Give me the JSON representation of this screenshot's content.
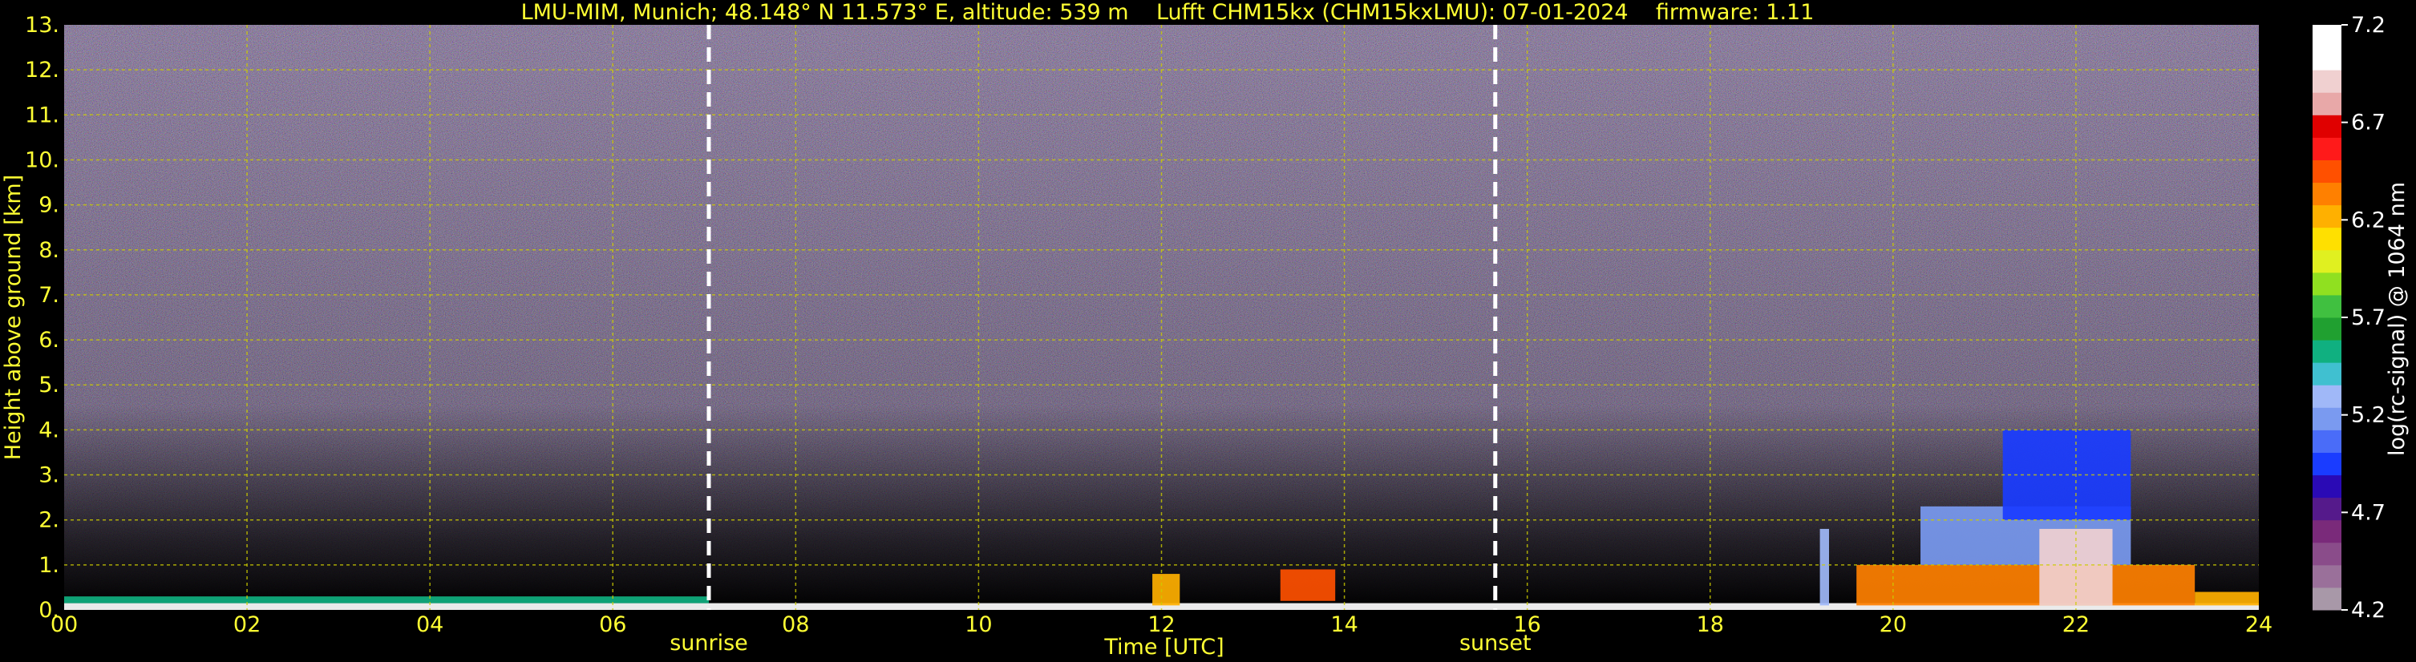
{
  "chart_data": [
    {
      "type": "heatmap",
      "title": "LMU-MIM, Munich; 48.148° N 11.573° E, altitude: 539 m    Lufft CHM15kx (CHM15kxLMU): 07-01-2024    firmware: 1.11",
      "xlabel": "Time [UTC]",
      "ylabel": "Height above ground [km]",
      "xlim": [
        0,
        24
      ],
      "ylim": [
        0,
        13
      ],
      "x_ticks": [
        "00",
        "02",
        "04",
        "06",
        "08",
        "10",
        "12",
        "14",
        "16",
        "18",
        "20",
        "22",
        "24"
      ],
      "x_tick_values": [
        0,
        2,
        4,
        6,
        8,
        10,
        12,
        14,
        16,
        18,
        20,
        22,
        24
      ],
      "y_ticks": [
        "0.",
        "1.",
        "2.",
        "3.",
        "4.",
        "5.",
        "6.",
        "7.",
        "8.",
        "9.",
        "10.",
        "11.",
        "12.",
        "13."
      ],
      "y_tick_values": [
        0,
        1,
        2,
        3,
        4,
        5,
        6,
        7,
        8,
        9,
        10,
        11,
        12,
        13
      ],
      "grid": true,
      "annotations": [
        {
          "label": "sunrise",
          "x": 7.05
        },
        {
          "label": "sunset",
          "x": 15.65
        }
      ],
      "signal_regions": [
        {
          "x": [
            0,
            24
          ],
          "y": [
            0,
            0.15
          ],
          "level": 7.0
        },
        {
          "x": [
            0,
            7.05
          ],
          "y": [
            0.15,
            0.3
          ],
          "level": 5.5
        },
        {
          "x": [
            11.9,
            12.2
          ],
          "y": [
            0.1,
            0.8
          ],
          "level": 6.2
        },
        {
          "x": [
            13.3,
            13.9
          ],
          "y": [
            0.2,
            0.9
          ],
          "level": 6.5
        },
        {
          "x": [
            19.2,
            19.3
          ],
          "y": [
            0.1,
            1.8
          ],
          "level": 5.3
        },
        {
          "x": [
            19.6,
            23.3
          ],
          "y": [
            0.1,
            1.0
          ],
          "level": 6.3
        },
        {
          "x": [
            20.3,
            22.6
          ],
          "y": [
            1.0,
            2.3
          ],
          "level": 5.2
        },
        {
          "x": [
            21.2,
            22.6
          ],
          "y": [
            2.0,
            4.0
          ],
          "level": 5.0
        },
        {
          "x": [
            21.6,
            22.4
          ],
          "y": [
            0.1,
            1.8
          ],
          "level": 6.9
        },
        {
          "x": [
            23.3,
            24
          ],
          "y": [
            0.1,
            0.4
          ],
          "level": 6.2
        }
      ]
    },
    {
      "type": "colorbar",
      "label": "log(rc-signal) @ 1064 nm",
      "range": [
        4.2,
        7.2
      ],
      "ticks": [
        "4.2",
        "4.7",
        "5.2",
        "5.7",
        "6.2",
        "6.7",
        "7.2"
      ],
      "tick_values": [
        4.2,
        4.7,
        5.2,
        5.7,
        6.2,
        6.7,
        7.2
      ],
      "colors": [
        "#a898a8",
        "#9a709a",
        "#8a4c8a",
        "#7a2a7a",
        "#551a8b",
        "#2a0ab5",
        "#1a3cff",
        "#4a6cf8",
        "#7a9af0",
        "#a0b8f8",
        "#40c0d0",
        "#10b080",
        "#20a030",
        "#40c040",
        "#90e020",
        "#e0f020",
        "#ffe000",
        "#ffb000",
        "#ff8000",
        "#ff5000",
        "#ff1a1a",
        "#e00000",
        "#e8a8a8",
        "#f0d0d0",
        "#ffffff",
        "#ffffff"
      ]
    }
  ]
}
